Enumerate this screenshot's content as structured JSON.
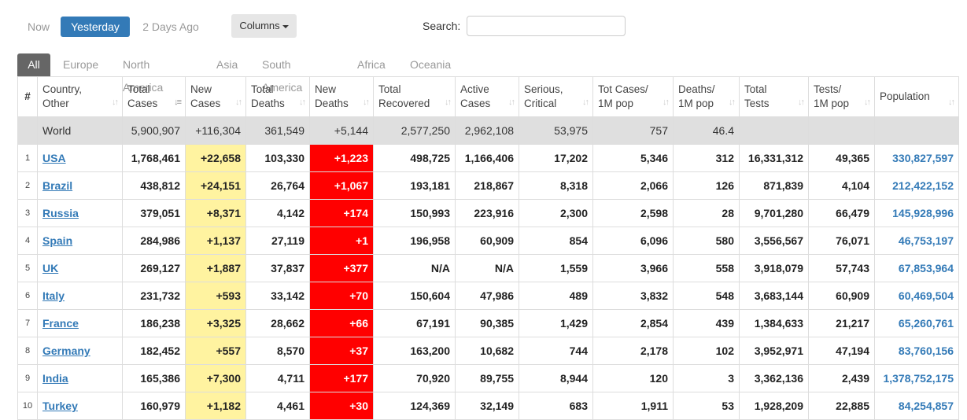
{
  "days": {
    "now": "Now",
    "yesterday": "Yesterday",
    "two_days": "2 Days Ago"
  },
  "columns_button": "Columns",
  "search": {
    "label": "Search:",
    "value": ""
  },
  "tabs": [
    "All",
    "Europe",
    "North America",
    "Asia",
    "South America",
    "Africa",
    "Oceania"
  ],
  "headers": [
    {
      "line1": "#",
      "line2": ""
    },
    {
      "line1": "Country,",
      "line2": "Other"
    },
    {
      "line1": "Total",
      "line2": "Cases"
    },
    {
      "line1": "New",
      "line2": "Cases"
    },
    {
      "line1": "Total",
      "line2": "Deaths"
    },
    {
      "line1": "New",
      "line2": "Deaths"
    },
    {
      "line1": "Total",
      "line2": "Recovered"
    },
    {
      "line1": "Active",
      "line2": "Cases"
    },
    {
      "line1": "Serious,",
      "line2": "Critical"
    },
    {
      "line1": "Tot Cases/",
      "line2": "1M pop"
    },
    {
      "line1": "Deaths/",
      "line2": "1M pop"
    },
    {
      "line1": "Total",
      "line2": "Tests"
    },
    {
      "line1": "Tests/",
      "line2": "1M pop"
    },
    {
      "line1": "Population",
      "line2": ""
    }
  ],
  "world": {
    "country": "World",
    "total_cases": "5,900,907",
    "new_cases": "+116,304",
    "total_deaths": "361,549",
    "new_deaths": "+5,144",
    "recovered": "2,577,250",
    "active": "2,962,108",
    "critical": "53,975",
    "cases_per_m": "757",
    "deaths_per_m": "46.4",
    "tests": "",
    "tests_per_m": "",
    "population": ""
  },
  "rows": [
    {
      "idx": "1",
      "country": "USA",
      "total_cases": "1,768,461",
      "new_cases": "+22,658",
      "total_deaths": "103,330",
      "new_deaths": "+1,223",
      "recovered": "498,725",
      "active": "1,166,406",
      "critical": "17,202",
      "cases_per_m": "5,346",
      "deaths_per_m": "312",
      "tests": "16,331,312",
      "tests_per_m": "49,365",
      "population": "330,827,597"
    },
    {
      "idx": "2",
      "country": "Brazil",
      "total_cases": "438,812",
      "new_cases": "+24,151",
      "total_deaths": "26,764",
      "new_deaths": "+1,067",
      "recovered": "193,181",
      "active": "218,867",
      "critical": "8,318",
      "cases_per_m": "2,066",
      "deaths_per_m": "126",
      "tests": "871,839",
      "tests_per_m": "4,104",
      "population": "212,422,152"
    },
    {
      "idx": "3",
      "country": "Russia",
      "total_cases": "379,051",
      "new_cases": "+8,371",
      "total_deaths": "4,142",
      "new_deaths": "+174",
      "recovered": "150,993",
      "active": "223,916",
      "critical": "2,300",
      "cases_per_m": "2,598",
      "deaths_per_m": "28",
      "tests": "9,701,280",
      "tests_per_m": "66,479",
      "population": "145,928,996"
    },
    {
      "idx": "4",
      "country": "Spain",
      "total_cases": "284,986",
      "new_cases": "+1,137",
      "total_deaths": "27,119",
      "new_deaths": "+1",
      "recovered": "196,958",
      "active": "60,909",
      "critical": "854",
      "cases_per_m": "6,096",
      "deaths_per_m": "580",
      "tests": "3,556,567",
      "tests_per_m": "76,071",
      "population": "46,753,197"
    },
    {
      "idx": "5",
      "country": "UK",
      "total_cases": "269,127",
      "new_cases": "+1,887",
      "total_deaths": "37,837",
      "new_deaths": "+377",
      "recovered": "N/A",
      "active": "N/A",
      "critical": "1,559",
      "cases_per_m": "3,966",
      "deaths_per_m": "558",
      "tests": "3,918,079",
      "tests_per_m": "57,743",
      "population": "67,853,964"
    },
    {
      "idx": "6",
      "country": "Italy",
      "total_cases": "231,732",
      "new_cases": "+593",
      "total_deaths": "33,142",
      "new_deaths": "+70",
      "recovered": "150,604",
      "active": "47,986",
      "critical": "489",
      "cases_per_m": "3,832",
      "deaths_per_m": "548",
      "tests": "3,683,144",
      "tests_per_m": "60,909",
      "population": "60,469,504"
    },
    {
      "idx": "7",
      "country": "France",
      "total_cases": "186,238",
      "new_cases": "+3,325",
      "total_deaths": "28,662",
      "new_deaths": "+66",
      "recovered": "67,191",
      "active": "90,385",
      "critical": "1,429",
      "cases_per_m": "2,854",
      "deaths_per_m": "439",
      "tests": "1,384,633",
      "tests_per_m": "21,217",
      "population": "65,260,761"
    },
    {
      "idx": "8",
      "country": "Germany",
      "total_cases": "182,452",
      "new_cases": "+557",
      "total_deaths": "8,570",
      "new_deaths": "+37",
      "recovered": "163,200",
      "active": "10,682",
      "critical": "744",
      "cases_per_m": "2,178",
      "deaths_per_m": "102",
      "tests": "3,952,971",
      "tests_per_m": "47,194",
      "population": "83,760,156"
    },
    {
      "idx": "9",
      "country": "India",
      "total_cases": "165,386",
      "new_cases": "+7,300",
      "total_deaths": "4,711",
      "new_deaths": "+177",
      "recovered": "70,920",
      "active": "89,755",
      "critical": "8,944",
      "cases_per_m": "120",
      "deaths_per_m": "3",
      "tests": "3,362,136",
      "tests_per_m": "2,439",
      "population": "1,378,752,175"
    },
    {
      "idx": "10",
      "country": "Turkey",
      "total_cases": "160,979",
      "new_cases": "+1,182",
      "total_deaths": "4,461",
      "new_deaths": "+30",
      "recovered": "124,369",
      "active": "32,149",
      "critical": "683",
      "cases_per_m": "1,911",
      "deaths_per_m": "53",
      "tests": "1,928,209",
      "tests_per_m": "22,885",
      "population": "84,254,857"
    }
  ]
}
